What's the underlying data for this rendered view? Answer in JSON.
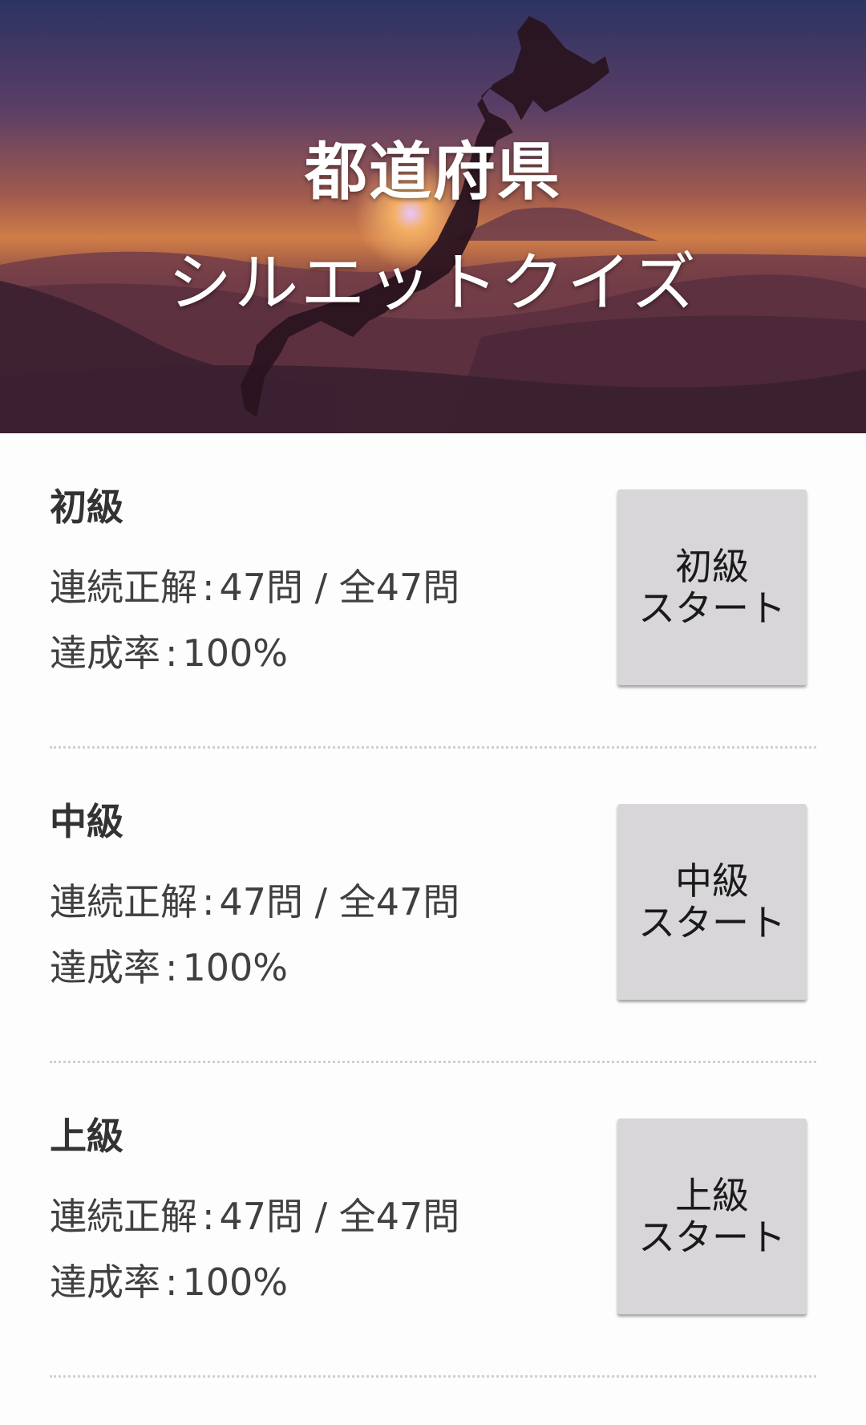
{
  "header": {
    "title_line1": "都道府県",
    "title_line2": "シルエットクイズ"
  },
  "levels": [
    {
      "name": "初級",
      "streak_label": "連続正解",
      "streak_value": "47問 / 全47問",
      "rate_label": "達成率",
      "rate_value": "100%",
      "button_line1": "初級",
      "button_line2": "スタート"
    },
    {
      "name": "中級",
      "streak_label": "連続正解",
      "streak_value": "47問 / 全47問",
      "rate_label": "達成率",
      "rate_value": "100%",
      "button_line1": "中級",
      "button_line2": "スタート"
    },
    {
      "name": "上級",
      "streak_label": "連続正解",
      "streak_value": "47問 / 全47問",
      "rate_label": "達成率",
      "rate_value": "100%",
      "button_line1": "上級",
      "button_line2": "スタート"
    }
  ],
  "colors": {
    "button_bg": "#d8d6d9",
    "text_primary": "#333333",
    "divider": "#cfcfcf",
    "banner_sky_top": "#2e3460",
    "banner_sky_mid": "#8a4a52",
    "banner_sun": "#f2b25a"
  },
  "icons": {
    "banner_image": "sunset-mountains-japan-silhouette"
  }
}
